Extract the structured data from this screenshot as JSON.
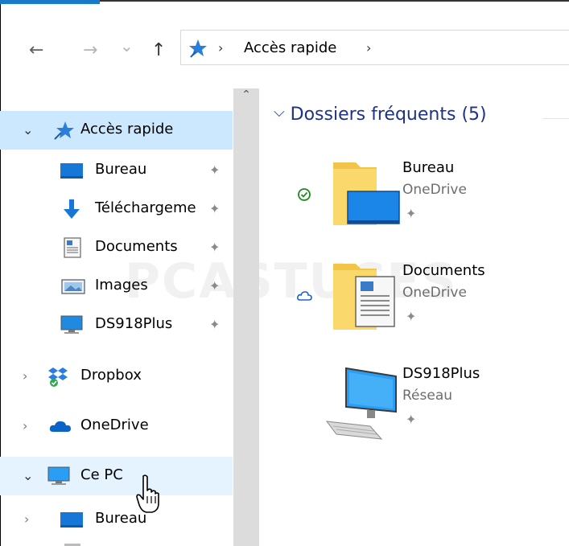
{
  "window": {
    "accent_color": "#1979ca"
  },
  "toolbar": {
    "back_icon": "arrow-left-icon",
    "forward_icon": "arrow-right-icon",
    "recent_icon": "chevron-down-icon",
    "up_icon": "arrow-up-icon",
    "back_glyph": "←",
    "forward_glyph": "→",
    "recent_glyph": "⌄",
    "up_glyph": "↑"
  },
  "address": {
    "location_icon": "quick-access-star-icon",
    "separator": "›",
    "path": "Accès rapide"
  },
  "sidebar": {
    "items": [
      {
        "label": "Accès rapide",
        "icon": "quick-access-star-icon",
        "expander": "⌄"
      },
      {
        "label": "Bureau",
        "icon": "desktop-folder-icon",
        "pinned": true
      },
      {
        "label": "Téléchargeme",
        "icon": "download-arrow-icon",
        "pinned": true
      },
      {
        "label": "Documents",
        "icon": "documents-icon",
        "pinned": true
      },
      {
        "label": "Images",
        "icon": "images-icon",
        "pinned": true
      },
      {
        "label": "DS918Plus",
        "icon": "network-computer-icon",
        "pinned": true
      },
      {
        "label": "Dropbox",
        "icon": "dropbox-icon",
        "expander": "›"
      },
      {
        "label": "OneDrive",
        "icon": "onedrive-cloud-icon",
        "expander": "›"
      },
      {
        "label": "Ce PC",
        "icon": "this-pc-icon",
        "expander": "⌄"
      },
      {
        "label": "Bureau",
        "icon": "desktop-folder-icon",
        "expander": "›"
      }
    ],
    "pin_glyph": "✦",
    "scroll_up_glyph": "⌃"
  },
  "content": {
    "group_chevron": "⌵",
    "group_title": "Dossiers fréquents (5)",
    "tiles": [
      {
        "name": "Bureau",
        "location": "OneDrive",
        "status_icon": "synced-check-icon",
        "icon": "desktop-folder-large-icon"
      },
      {
        "name": "Documents",
        "location": "OneDrive",
        "status_icon": "cloud-only-icon",
        "icon": "documents-folder-large-icon"
      },
      {
        "name": "DS918Plus",
        "location": "Réseau",
        "status_icon": null,
        "icon": "network-computer-large-icon"
      }
    ],
    "pin_glyph": "✦"
  },
  "watermark": "PCASTUCES"
}
